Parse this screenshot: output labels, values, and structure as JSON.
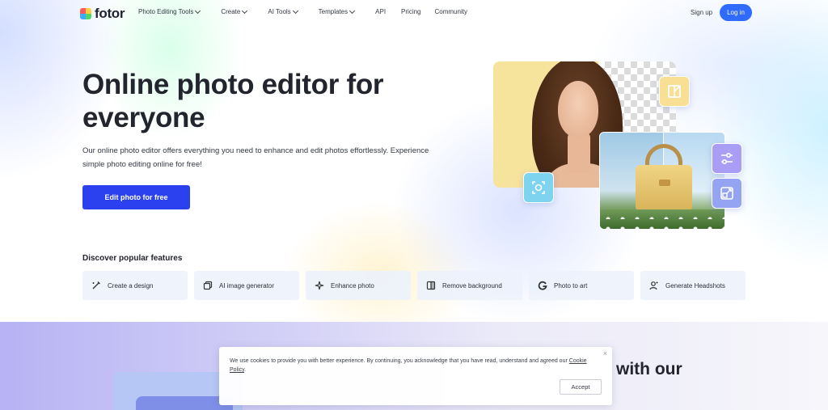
{
  "brand": {
    "name": "fotor",
    "colors": [
      "#2f6bff",
      "#2b41f0",
      "#f8df94",
      "#a99df5"
    ]
  },
  "nav": {
    "items": [
      {
        "label": "Photo Editing Tools",
        "has_dropdown": true
      },
      {
        "label": "Create",
        "has_dropdown": true
      },
      {
        "label": "AI Tools",
        "has_dropdown": true
      },
      {
        "label": "Templates",
        "has_dropdown": true
      },
      {
        "label": "API",
        "has_dropdown": false
      },
      {
        "label": "Pricing",
        "has_dropdown": false
      },
      {
        "label": "Community",
        "has_dropdown": false
      }
    ],
    "sign_up": "Sign up",
    "log_in": "Log in"
  },
  "hero": {
    "title": "Online photo editor for everyone",
    "description": "Our online photo editor offers everything you need to enhance and edit photos effortlessly. Experience simple photo editing online for free!",
    "cta": "Edit photo for free"
  },
  "features": {
    "title": "Discover popular features",
    "items": [
      {
        "label": "Create a design",
        "icon": "magic-wand-icon"
      },
      {
        "label": "AI image generator",
        "icon": "layers-icon"
      },
      {
        "label": "Enhance photo",
        "icon": "sparkle-icon"
      },
      {
        "label": "Remove background",
        "icon": "cutout-icon"
      },
      {
        "label": "Photo to art",
        "icon": "art-icon"
      },
      {
        "label": "Generate Headshots",
        "icon": "user-icon"
      }
    ]
  },
  "lower": {
    "heading_partial": "with our"
  },
  "cookie": {
    "text": "We use cookies to provide you with better experience. By continuing, you acknowledge that you have read, understand and agreed our",
    "link": "Cookie Policy",
    "suffix": ".",
    "accept": "Accept",
    "close": "×"
  }
}
